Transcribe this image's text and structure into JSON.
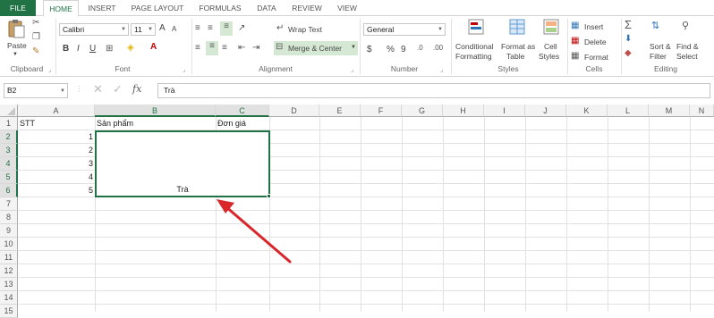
{
  "tabs": [
    "FILE",
    "HOME",
    "INSERT",
    "PAGE LAYOUT",
    "FORMULAS",
    "DATA",
    "REVIEW",
    "VIEW"
  ],
  "ribbon": {
    "clipboard": {
      "paste": "Paste",
      "label": "Clipboard"
    },
    "font": {
      "name": "Calibri",
      "size": "11",
      "bold": "B",
      "italic": "I",
      "underline": "U",
      "grow": "A",
      "shrink": "A",
      "label": "Font"
    },
    "alignment": {
      "wrap_text": "Wrap Text",
      "merge_center": "Merge & Center",
      "label": "Alignment"
    },
    "number": {
      "format": "General",
      "currency": "$",
      "percent": "%",
      "comma": "9",
      "label": "Number"
    },
    "styles": {
      "conditional_1": "Conditional",
      "conditional_2": "Formatting",
      "format_as_1": "Format as",
      "format_as_2": "Table",
      "cell_styles_1": "Cell",
      "cell_styles_2": "Styles",
      "label": "Styles"
    },
    "cells": {
      "insert": "Insert",
      "delete": "Delete",
      "format": "Format",
      "label": "Cells"
    },
    "editing": {
      "sort_1": "Sort &",
      "sort_2": "Filter",
      "find_1": "Find &",
      "find_2": "Select",
      "label": "Editing"
    }
  },
  "formula_bar": {
    "name_box": "B2",
    "fx": "fx",
    "content": "Trà"
  },
  "columns": [
    "A",
    "B",
    "C",
    "D",
    "E",
    "F",
    "G",
    "H",
    "I",
    "J",
    "K",
    "L",
    "M",
    "N"
  ],
  "rows": [
    "1",
    "2",
    "3",
    "4",
    "5",
    "6",
    "7",
    "8",
    "9",
    "10",
    "11",
    "12",
    "13",
    "14",
    "15"
  ],
  "cells": {
    "A1": "STT",
    "B1": "Sản phẩm",
    "C1": "Đơn giá",
    "A2": "1",
    "A3": "2",
    "A4": "3",
    "A5": "4",
    "A6": "5",
    "merged": "Trà"
  },
  "colors": {
    "accent": "#217346",
    "arrow": "#d9262b"
  }
}
